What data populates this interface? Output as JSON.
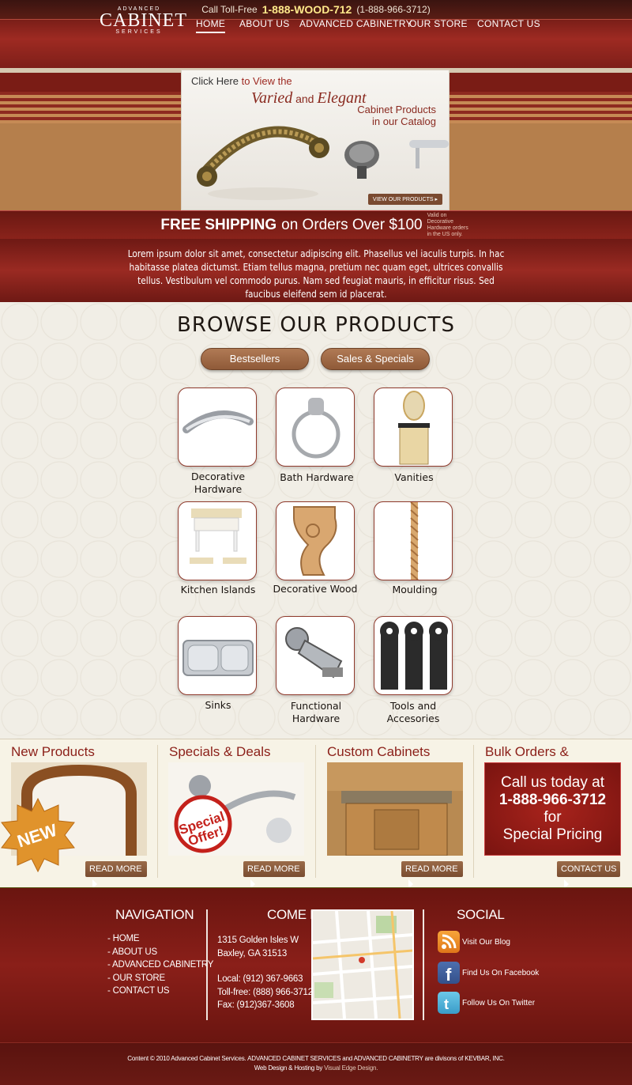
{
  "topbar": {
    "prefix": "Call Toll-Free",
    "phone_vanity": "1-888-WOOD-712",
    "phone_numeric": "(1-888-966-3712)"
  },
  "logo": {
    "line1": "ADVANCED",
    "line2": "CABINET",
    "line3": "SERVICES"
  },
  "nav": [
    "HOME",
    "ABOUT US",
    "ADVANCED CABINETRY",
    "OUR STORE",
    "CONTACT US"
  ],
  "hero": {
    "click": "Click Here",
    "to_view": " to View the",
    "varied": "Varied",
    "and": " and ",
    "elegant": "Elegant",
    "line3": "Cabinet Products",
    "line4": "in our Catalog",
    "button": "VIEW OUR PRODUCTS"
  },
  "shipping": {
    "bold": "FREE SHIPPING",
    "rest": "on Orders Over $100",
    "note": "Valid on Decorative Hardware orders in the US only."
  },
  "intro": "Lorem ipsum dolor sit amet, consectetur adipiscing elit. Phasellus vel iaculis turpis. In hac habitasse platea dictumst. Etiam tellus magna, pretium nec quam eget, ultrices convallis tellus. Vestibulum vel commodo purus. Nam sed feugiat mauris, in efficitur risus. Sed faucibus eleifend sem id placerat.",
  "browse": {
    "title": "BROWSE OUR PRODUCTS",
    "tabs": [
      "Bestsellers",
      "Sales & Specials"
    ],
    "products": [
      [
        "Decorative",
        "Hardware"
      ],
      [
        "Bath Hardware"
      ],
      [
        "Vanities"
      ],
      [
        "Kitchen Islands"
      ],
      [
        "Decorative Wood"
      ],
      [
        "Moulding"
      ],
      [
        "Sinks"
      ],
      [
        "Functional",
        "Hardware"
      ],
      [
        "Tools and",
        "Accesories"
      ]
    ]
  },
  "promos": {
    "headings": [
      "New Products",
      "Specials & Deals",
      "Custom Cabinets",
      "Bulk Orders & Wholesale"
    ],
    "new_badge": "NEW",
    "special_badge": "Special Offer!",
    "read_more": "READ MORE",
    "contact_us": "CONTACT US",
    "call": {
      "l1": "Call us today at",
      "num": "1-888-966-3712",
      "l3": "for",
      "l4": "Special Pricing"
    }
  },
  "footer": {
    "nav_title": "NAVIGATION",
    "nav_links": [
      "- HOME",
      "- ABOUT US",
      "- ADVANCED CABINETRY",
      "- OUR STORE",
      "- CONTACT US"
    ],
    "meet_title": "COME MEET US",
    "address1": "1315 Golden Isles W",
    "address2": "Baxley, GA 31513",
    "local": "Local: (912) 367-9663",
    "tollfree": "Toll-free: (888) 966-3712",
    "fax": "Fax: (912)367-3608",
    "social_title": "SOCIAL",
    "social": [
      "Visit Our Blog",
      "Find Us On Facebook",
      "Follow Us On Twitter"
    ],
    "copyright": "Content © 2010 Advanced Cabinet Services. ADVANCED CABINET SERVICES and ADVANCED CABINETRY are divisons of KEVBAR, INC.",
    "credit_prefix": "Web Design & Hosting by",
    "credit_name": "Visual Edge Design."
  },
  "colors": {
    "maroon": "#8a231b",
    "brown": "#8f5a38",
    "accent_yellow": "#ffe98a"
  }
}
